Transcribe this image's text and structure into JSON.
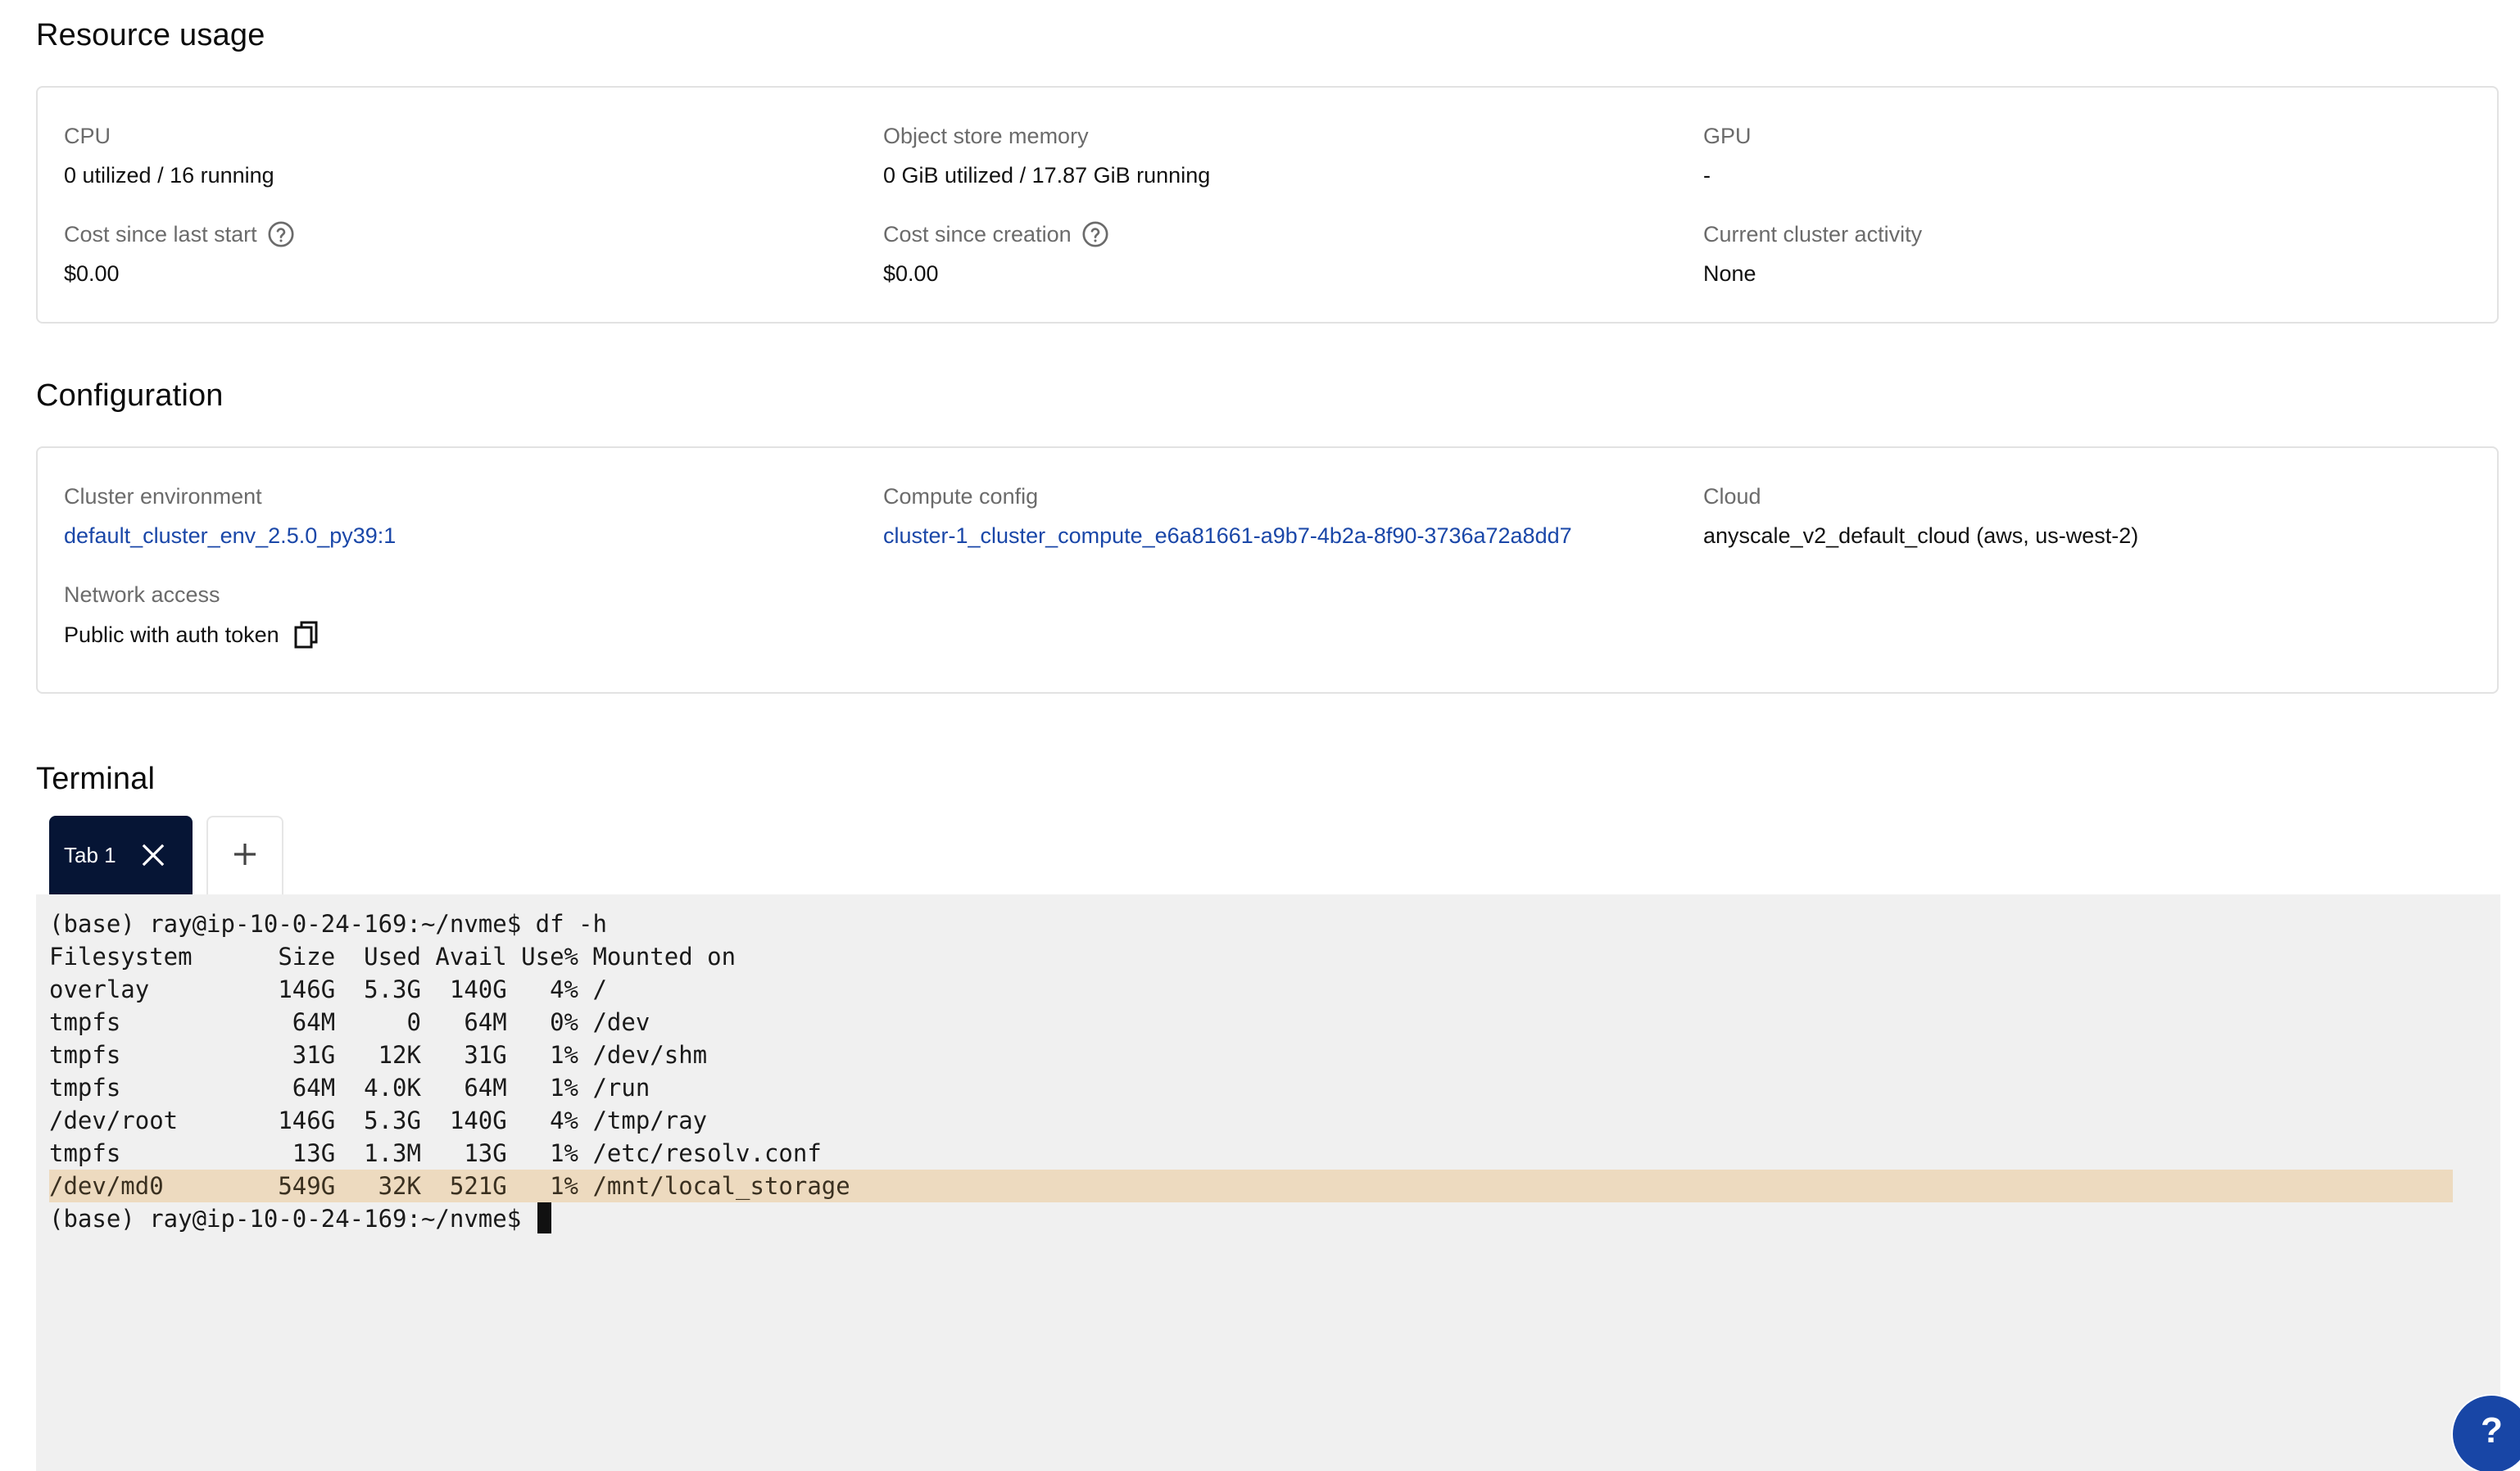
{
  "resource_usage": {
    "title": "Resource usage",
    "cpu": {
      "label": "CPU",
      "value": "0 utilized / 16 running"
    },
    "object_store_memory": {
      "label": "Object store memory",
      "value": "0 GiB utilized / 17.87 GiB running"
    },
    "gpu": {
      "label": "GPU",
      "value": "-"
    },
    "cost_since_last_start": {
      "label": "Cost since last start",
      "value": "$0.00",
      "icon": "help-circle-icon"
    },
    "cost_since_creation": {
      "label": "Cost since creation",
      "value": "$0.00",
      "icon": "help-circle-icon"
    },
    "current_cluster_activity": {
      "label": "Current cluster activity",
      "value": "None"
    }
  },
  "configuration": {
    "title": "Configuration",
    "cluster_environment": {
      "label": "Cluster environment",
      "value": "default_cluster_env_2.5.0_py39:1"
    },
    "compute_config": {
      "label": "Compute config",
      "value": "cluster-1_cluster_compute_e6a81661-a9b7-4b2a-8f90-3736a72a8dd7"
    },
    "cloud": {
      "label": "Cloud",
      "value": "anyscale_v2_default_cloud (aws, us-west-2)"
    },
    "network_access": {
      "label": "Network access",
      "value": "Public with auth token",
      "icon": "copy-icon"
    }
  },
  "terminal": {
    "title": "Terminal",
    "tabs": [
      {
        "label": "Tab 1",
        "active": true,
        "close_icon": "close-icon"
      }
    ],
    "add_tab_icon": "plus-icon",
    "lines": [
      "(base) ray@ip-10-0-24-169:~/nvme$ df -h",
      "Filesystem      Size  Used Avail Use% Mounted on",
      "overlay         146G  5.3G  140G   4% /",
      "tmpfs            64M     0   64M   0% /dev",
      "tmpfs            31G   12K   31G   1% /dev/shm",
      "tmpfs            64M  4.0K   64M   1% /run",
      "/dev/root       146G  5.3G  140G   4% /tmp/ray",
      "tmpfs            13G  1.3M   13G   1% /etc/resolv.conf",
      "/dev/md0        549G   32K  521G   1% /mnt/local_storage",
      "(base) ray@ip-10-0-24-169:~/nvme$ "
    ],
    "highlighted_line_index": 8,
    "colors": {
      "background": "#f0f0f0",
      "highlight": "#eddabf",
      "active_tab": "#061535"
    }
  },
  "help_button": {
    "label": "?",
    "color": "#1846a6"
  },
  "colors": {
    "link": "#1a47a8",
    "label": "#6b6b6b",
    "card_border": "#e2e2e2"
  }
}
